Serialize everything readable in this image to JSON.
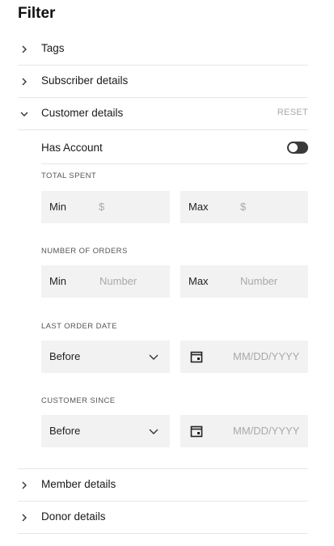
{
  "title": "Filter",
  "sections": {
    "tags": "Tags",
    "subscriber": "Subscriber details",
    "customer": "Customer details",
    "member": "Member details",
    "donor": "Donor details"
  },
  "reset_label": "RESET",
  "has_account": {
    "label": "Has Account",
    "enabled": false
  },
  "total_spent": {
    "caption": "TOTAL SPENT",
    "min_label": "Min",
    "min_placeholder": "$",
    "max_label": "Max",
    "max_placeholder": "$"
  },
  "number_of_orders": {
    "caption": "NUMBER OF ORDERS",
    "min_label": "Min",
    "min_placeholder": "Number",
    "max_label": "Max",
    "max_placeholder": "Number"
  },
  "last_order_date": {
    "caption": "LAST ORDER DATE",
    "selected": "Before",
    "date_placeholder": "MM/DD/YYYY"
  },
  "customer_since": {
    "caption": "CUSTOMER SINCE",
    "selected": "Before",
    "date_placeholder": "MM/DD/YYYY"
  },
  "icons": {
    "collapsed": "chevron-right-icon",
    "expanded": "chevron-down-icon",
    "select": "chevron-down-icon",
    "date": "calendar-icon"
  },
  "colors": {
    "field_bg": "#f2f2f2",
    "toggle_off": "#3a3a3a",
    "reset": "#a8a8a8"
  }
}
